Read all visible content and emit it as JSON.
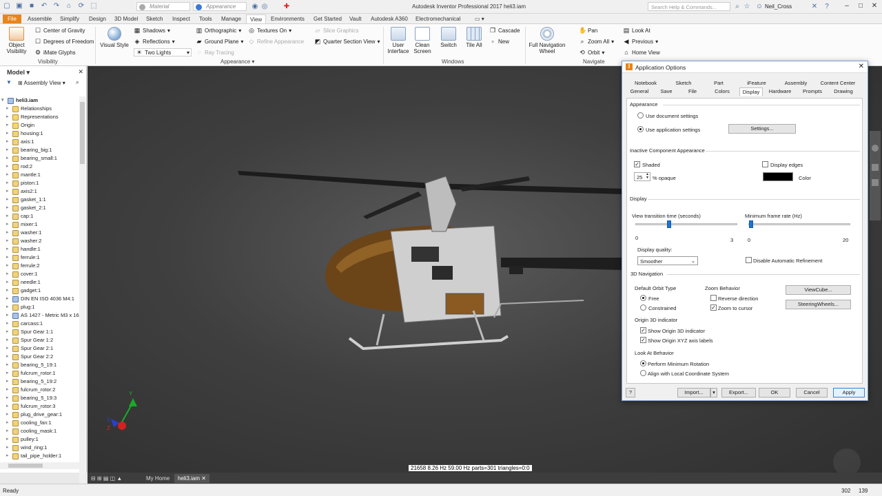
{
  "titlebar": {
    "app_title": "Autodesk Inventor Professional 2017   heli3.iam",
    "material_select": "Material",
    "appearance_select": "Appearance",
    "search_placeholder": "Search Help & Commands...",
    "user_name": "Neil_Cross"
  },
  "ribbon_tabs": [
    "File",
    "Assemble",
    "Simplify",
    "Design",
    "3D Model",
    "Sketch",
    "Inspect",
    "Tools",
    "Manage",
    "View",
    "Environments",
    "Get Started",
    "Vault",
    "Autodesk A360",
    "Electromechanical"
  ],
  "active_ribbon_tab": "View",
  "ribbon": {
    "visibility": {
      "object_visibility": "Object Visibility",
      "center_of_gravity": "Center of Gravity",
      "degrees_of_freedom": "Degrees of Freedom",
      "imate_glyphs": "iMate Glyphs",
      "group": "Visibility"
    },
    "appearance": {
      "visual_style": "Visual Style",
      "shadows": "Shadows",
      "reflections": "Reflections",
      "lighting": "Two Lights",
      "orthographic": "Orthographic",
      "ground_plane": "Ground Plane",
      "ray_tracing": "Ray Tracing",
      "textures_on": "Textures On",
      "refine_appearance": "Refine Appearance",
      "slice_graphics": "Slice Graphics",
      "quarter_section": "Quarter Section View",
      "group": "Appearance"
    },
    "windows": {
      "user_interface": "User Interface",
      "clean_screen": "Clean Screen",
      "switch": "Switch",
      "tile_all": "Tile All",
      "cascade": "Cascade",
      "new": "New",
      "group": "Windows"
    },
    "navigate": {
      "full_nav_wheel": "Full Navigation Wheel",
      "pan": "Pan",
      "zoom_all": "Zoom All",
      "orbit": "Orbit",
      "look_at": "Look At",
      "previous": "Previous",
      "home_view": "Home View",
      "group": "Navigate"
    }
  },
  "browser": {
    "title": "Model",
    "view": "Assembly View",
    "root": "heli3.iam",
    "items": [
      "Relationships",
      "Representations",
      "Origin",
      "housing:1",
      "axis:1",
      "bearing_big:1",
      "bearing_small:1",
      "rod:2",
      "mantle:1",
      "piston:1",
      "axis2:1",
      "gasket_1:1",
      "gasket_2:1",
      "cap:1",
      "mixer:1",
      "washer:1",
      "washer:2",
      "handle:1",
      "ferrule:1",
      "ferrule:2",
      "cover:1",
      "needle:1",
      "gadget:1",
      "DIN EN ISO 4036 M4:1",
      "plug:1",
      "AS 1427 - Metric M3 x 16:",
      "carcass:1",
      "Spur Gear 1:1",
      "Spur Gear 1:2",
      "Spur Gear 2:1",
      "Spur Gear 2:2",
      "bearing_5_19:1",
      "fulcrum_rotor:1",
      "bearing_5_19:2",
      "fulcrum_rotor:2",
      "bearing_5_19:3",
      "fulcrum_rotor:3",
      "plug_drive_gear:1",
      "cooling_fan:1",
      "cooling_mask:1",
      "pulley:1",
      "wind_ring:1",
      "tail_pipe_holder:1"
    ]
  },
  "viewport": {
    "perf_readout": "21658  8.26 Hz  59.00 Hz  parts=301 triangles=0:0"
  },
  "doc_tabs": {
    "home": "My Home",
    "doc": "heli3.iam"
  },
  "status": {
    "left": "Ready",
    "num1": "302",
    "num2": "139"
  },
  "dialog": {
    "title": "Application Options",
    "tabs_row1": [
      "Notebook",
      "Sketch",
      "Part",
      "iFeature",
      "Assembly",
      "Content Center"
    ],
    "tabs_row2": [
      "General",
      "Save",
      "File",
      "Colors",
      "Display",
      "Hardware",
      "Prompts",
      "Drawing"
    ],
    "active_tab": "Display",
    "appearance": {
      "section": "Appearance",
      "use_document": "Use document settings",
      "use_application": "Use application settings",
      "selected": "Use application settings",
      "settings_button": "Settings..."
    },
    "inactive": {
      "section": "Inactive Component Appearance",
      "shaded": "Shaded",
      "shaded_checked": true,
      "opacity_value": "25",
      "opacity_label": "% opaque",
      "display_edges": "Display edges",
      "display_edges_checked": false,
      "color_label": "Color",
      "color_value": "#000000"
    },
    "display": {
      "section": "Display",
      "view_transition_label": "View transition time (seconds)",
      "view_transition_min": "0",
      "view_transition_max": "3",
      "view_transition_value": 1.0,
      "min_frame_label": "Minimum frame rate (Hz)",
      "min_frame_min": "0",
      "min_frame_max": "20",
      "min_frame_value": 0.5,
      "quality_label": "Display quality:",
      "quality_value": "Smoother",
      "disable_refinement": "Disable Automatic Refinement",
      "disable_refinement_checked": false
    },
    "nav3d": {
      "section": "3D Navigation",
      "orbit_type_label": "Default Orbit Type",
      "orbit_free": "Free",
      "orbit_constrained": "Constrained",
      "orbit_selected": "Free",
      "zoom_label": "Zoom Behavior",
      "reverse_direction": "Reverse direction",
      "reverse_checked": false,
      "zoom_to_cursor": "Zoom to cursor",
      "zoom_to_cursor_checked": true,
      "viewcube_button": "ViewCube...",
      "steeringwheels_button": "SteeringWheels...",
      "origin_label": "Origin 3D indicator",
      "show_origin": "Show Origin 3D indicator",
      "show_origin_checked": true,
      "show_axis_labels": "Show Origin XYZ axis labels",
      "show_axis_labels_checked": true,
      "look_at_label": "Look At Behavior",
      "perform_min_rotation": "Perform Minimum Rotation",
      "align_local": "Align with Local Coordinate System",
      "look_at_selected": "Perform Minimum Rotation"
    },
    "footer": {
      "help": "?",
      "import": "Import...",
      "export": "Export...",
      "ok": "OK",
      "cancel": "Cancel",
      "apply": "Apply"
    }
  },
  "colors": {
    "file_tab": "#e8841a",
    "accent": "#1a74d6",
    "viewport_bg": "#3f3f3f"
  }
}
